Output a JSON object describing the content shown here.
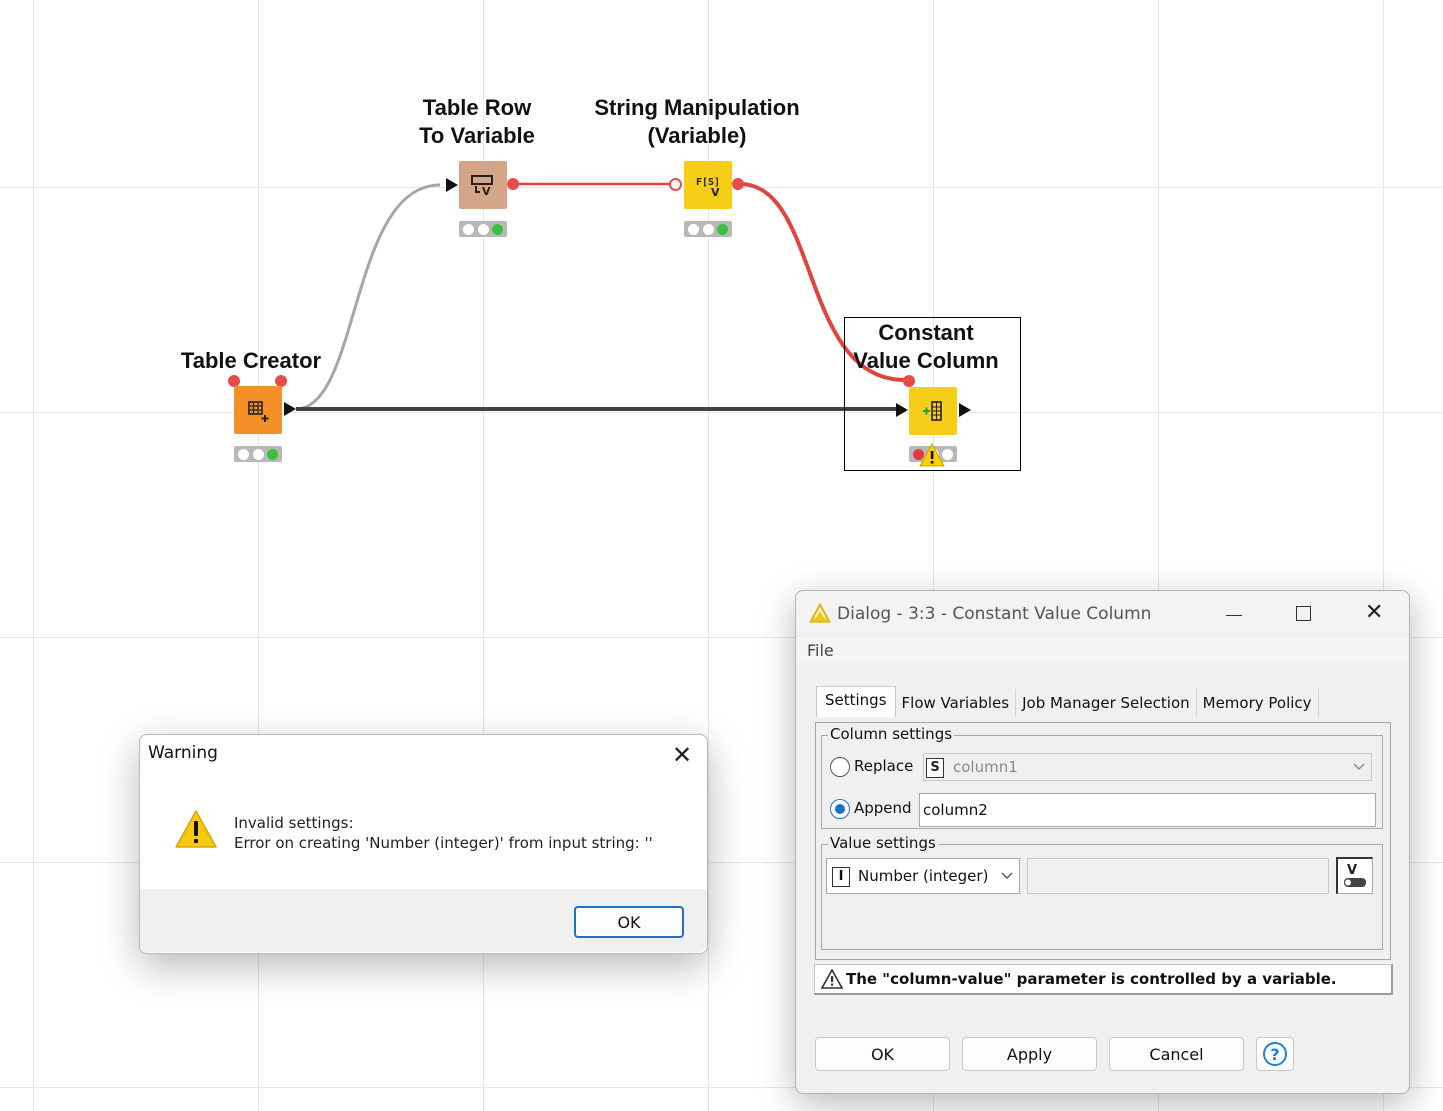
{
  "workflow": {
    "nodes": {
      "table_row_to_variable": {
        "label_line1": "Table Row",
        "label_line2": "To Variable"
      },
      "string_manipulation": {
        "label_line1": "String Manipulation",
        "label_line2": "(Variable)"
      },
      "table_creator": {
        "label": "Table Creator"
      },
      "constant_value_column": {
        "label_line1": "Constant",
        "label_line2": "Value Column"
      }
    },
    "icons": {
      "table_row_to_variable": "row-to-variable-icon",
      "string_manipulation": "string-function-icon",
      "table_creator": "table-plus-icon",
      "constant_value_column": "add-column-icon"
    },
    "colors": {
      "manipulator_node": "#d5a587",
      "flow_node": "#f6cd17",
      "source_node": "#f39128",
      "flow_variable_connection": "#e0443c",
      "data_connection": "#424242",
      "variable_connection_gray": "#a6a6a6"
    }
  },
  "warning_dialog": {
    "title": "Warning",
    "message_line1": "Invalid settings:",
    "message_line2": "Error on creating 'Number (integer)' from input string: ''",
    "ok_label": "OK"
  },
  "cvc_dialog": {
    "title": "Dialog - 3:3 - Constant Value Column",
    "menu_file": "File",
    "tabs": [
      "Settings",
      "Flow Variables",
      "Job Manager Selection",
      "Memory Policy"
    ],
    "column_settings": {
      "title": "Column settings",
      "replace_label": "Replace",
      "replace_type": "S",
      "replace_value": "column1",
      "append_label": "Append",
      "append_value": "column2",
      "selected": "Append"
    },
    "value_settings": {
      "title": "Value settings",
      "type_badge": "I",
      "type_label": "Number (integer)",
      "value": ""
    },
    "variable_notice": "The \"column-value\" parameter is controlled by a variable.",
    "buttons": {
      "ok": "OK",
      "apply": "Apply",
      "cancel": "Cancel"
    }
  }
}
